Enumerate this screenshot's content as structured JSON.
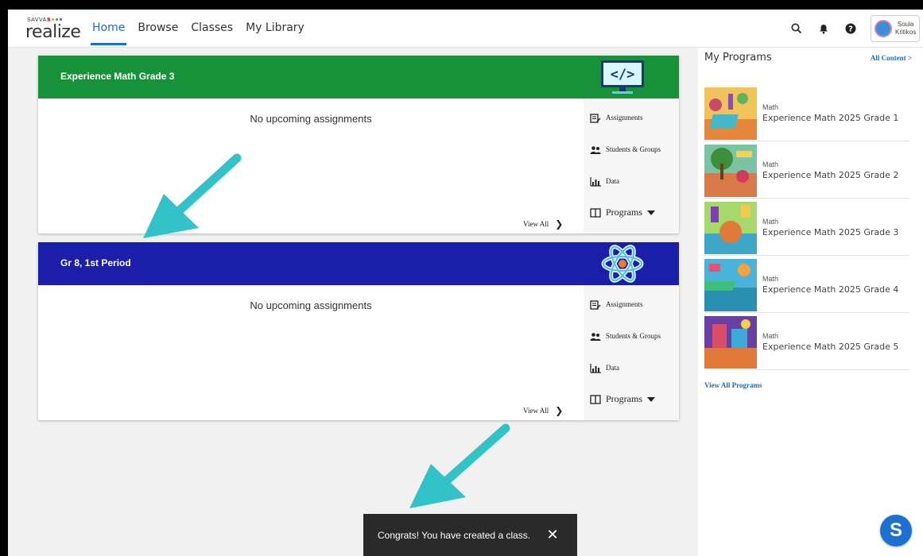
{
  "header": {
    "logo_brand": "SAVVAS",
    "logo_word": "realize",
    "nav": [
      {
        "label": "Home",
        "active": true
      },
      {
        "label": "Browse",
        "active": false
      },
      {
        "label": "Classes",
        "active": false
      },
      {
        "label": "My Library",
        "active": false
      }
    ],
    "icons": [
      "search-icon",
      "bell-icon",
      "help-icon"
    ],
    "user": {
      "first": "Soula",
      "last": "Kritikos"
    }
  },
  "classes": [
    {
      "title": "Experience Math Grade 3",
      "header_color": "#17923a",
      "art_icon": "code-monitor-icon",
      "no_assignments": "No upcoming assignments",
      "links": {
        "assignments": "Assignments",
        "students": "Students & Groups",
        "data": "Data",
        "programs": "Programs"
      },
      "view_all": "View All"
    },
    {
      "title": "Gr 8, 1st Period",
      "header_color": "#1a1ea8",
      "art_icon": "atom-icon",
      "no_assignments": "No upcoming assignments",
      "links": {
        "assignments": "Assignments",
        "students": "Students & Groups",
        "data": "Data",
        "programs": "Programs"
      },
      "view_all": "View All"
    }
  ],
  "my_programs": {
    "title": "My Programs",
    "all_content": "All Content >",
    "items": [
      {
        "subject": "Math",
        "name": "Experience Math 2025 Grade 1"
      },
      {
        "subject": "Math",
        "name": "Experience Math 2025 Grade 2"
      },
      {
        "subject": "Math",
        "name": "Experience Math 2025 Grade 3"
      },
      {
        "subject": "Math",
        "name": "Experience Math 2025 Grade 4"
      },
      {
        "subject": "Math",
        "name": "Experience Math 2025 Grade 5"
      }
    ],
    "view_all": "View All Programs"
  },
  "toast": {
    "message": "Congrats! You have created a class.",
    "close": "✕"
  },
  "fab_letter": "S",
  "colors": {
    "accent": "#1e6fc0",
    "arrow": "#33c2c8"
  }
}
